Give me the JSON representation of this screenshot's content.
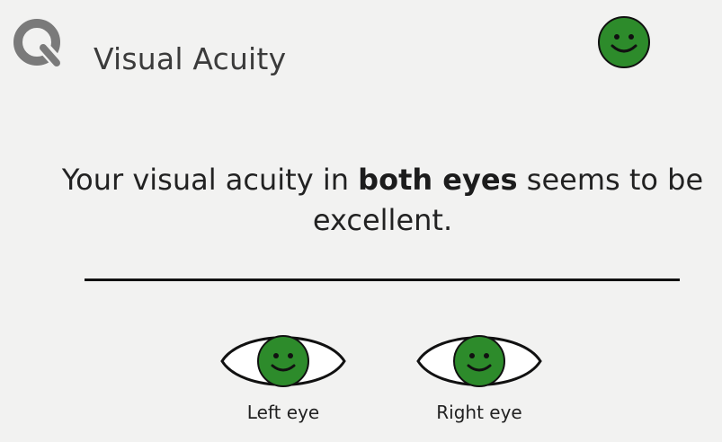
{
  "header": {
    "title": "Visual Acuity",
    "logo_icon": "magnifier-q-logo",
    "status_icon": "smiley-face-icon",
    "status_color": "#2d8b2b"
  },
  "result": {
    "text_before": "Your visual acuity in ",
    "text_emphasis": "both eyes",
    "text_after": " seems to be excellent."
  },
  "eyes": [
    {
      "label": "Left eye",
      "status_icon": "smiley-face-icon",
      "status_color": "#2d8b2b"
    },
    {
      "label": "Right eye",
      "status_icon": "smiley-face-icon",
      "status_color": "#2d8b2b"
    }
  ],
  "colors": {
    "positive": "#2d8b2b",
    "logo": "#7a7a7a",
    "background": "#f2f2f1"
  }
}
